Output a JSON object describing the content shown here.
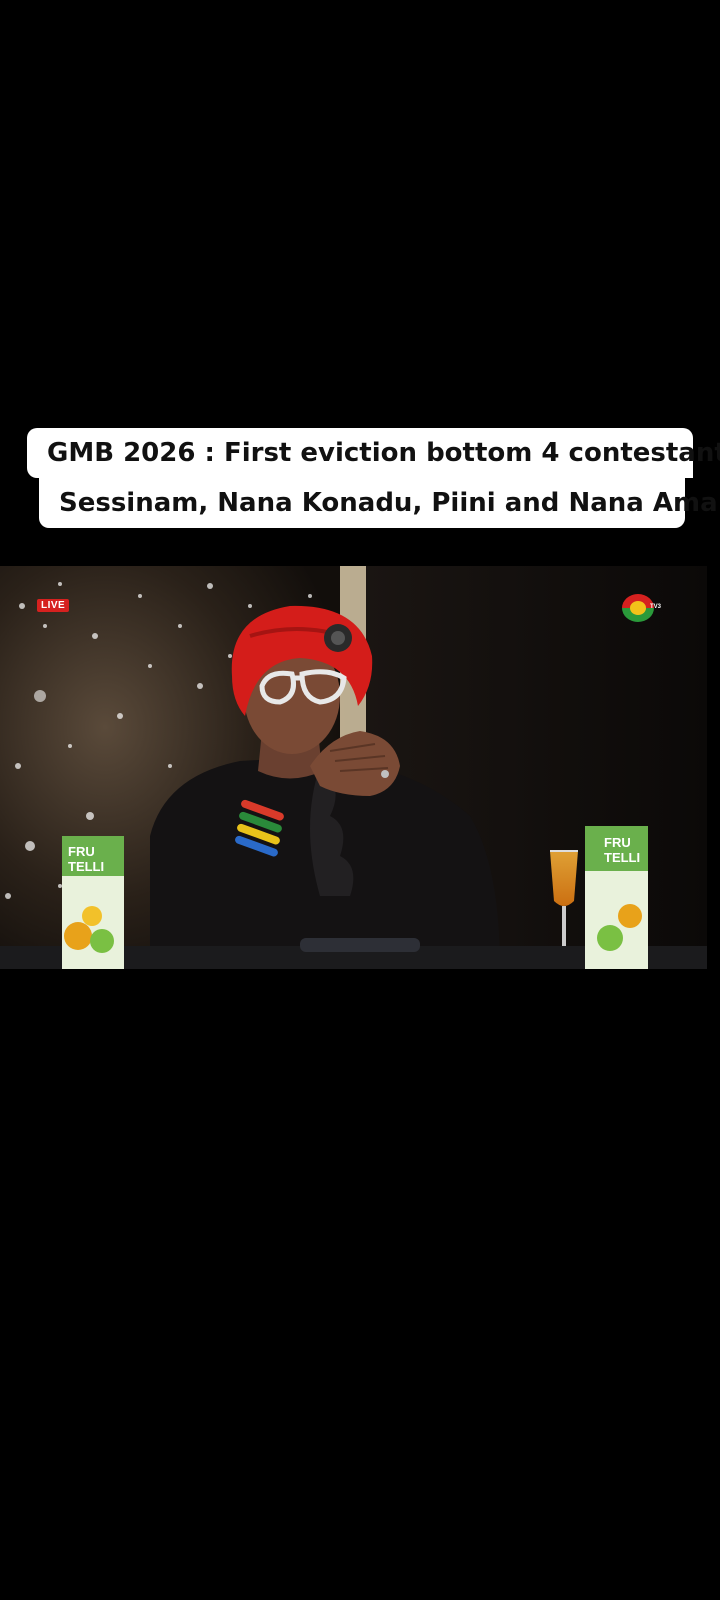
{
  "caption": {
    "line1": "GMB 2026 : First eviction bottom 4 contestant",
    "line2": "Sessinam,  Nana Konadu,  Piini and Nana Ama"
  },
  "video": {
    "live_badge": "LIVE",
    "channel_logo_text": "TV3",
    "product_label": "FRU TELLI"
  },
  "colors": {
    "background": "#000000",
    "caption_bg": "#ffffff",
    "caption_text": "#111111",
    "live_red": "#d6211f"
  }
}
